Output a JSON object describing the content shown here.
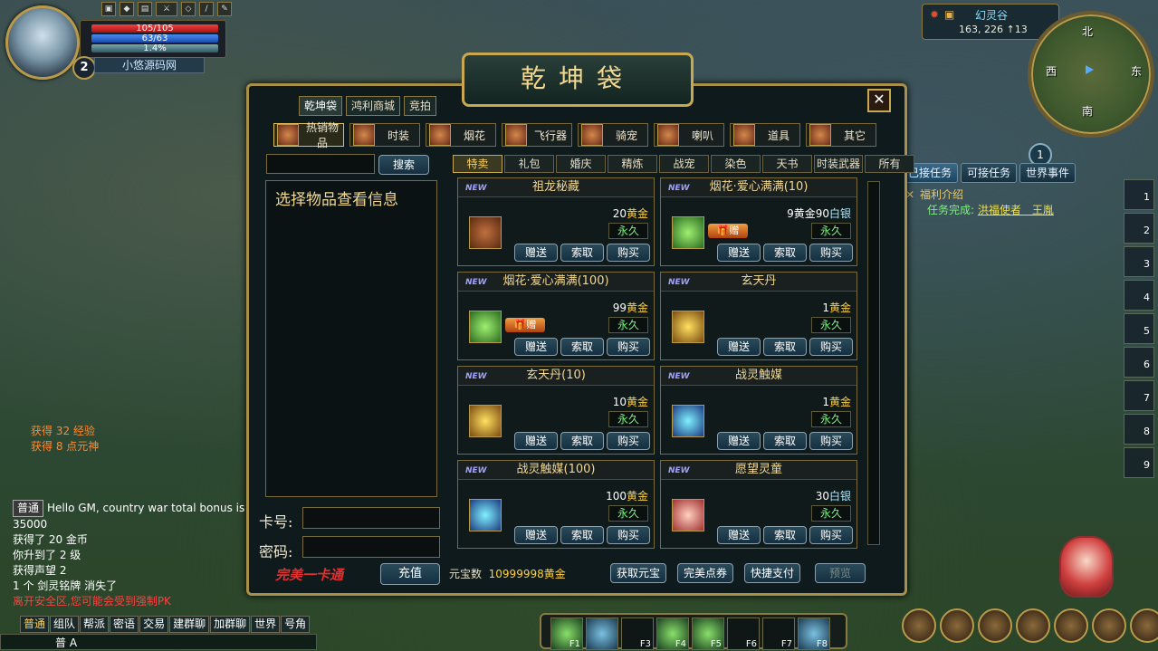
{
  "player": {
    "hp": "105/105",
    "mp": "63/63",
    "exp": "1.4%",
    "level": "2",
    "name": "小悠源码网"
  },
  "location": {
    "zone": "幻灵谷",
    "coords": "163, 226",
    "alt": "↑13"
  },
  "minimap": {
    "north": "北",
    "south": "南",
    "east": "东",
    "west": "西",
    "count": "1"
  },
  "quest_tabs": [
    "已接任务",
    "可接任务",
    "世界事件"
  ],
  "quest": {
    "title": "福利介绍",
    "status": "任务完成:",
    "target": "洪福使者　王胤"
  },
  "hotbar_right": [
    "1",
    "2",
    "3",
    "4",
    "5",
    "6",
    "7",
    "8",
    "9"
  ],
  "window": {
    "title": "乾坤袋",
    "top_tabs": [
      "乾坤袋",
      "鸿利商城",
      "竞拍"
    ],
    "categories": [
      "热销物品",
      "时装",
      "烟花",
      "飞行器",
      "骑宠",
      "喇叭",
      "道具",
      "其它"
    ],
    "search_label": "搜索",
    "info_text": "选择物品查看信息",
    "sub_tabs": [
      "特卖",
      "礼包",
      "婚庆",
      "精炼",
      "战宠",
      "染色",
      "天书",
      "时装武器",
      "所有"
    ],
    "card_label": "卡号:",
    "pwd_label": "密码:",
    "slogan": "完美一卡通",
    "charge_label": "充值",
    "balance_label": "元宝数",
    "balance_value": "10999998黄金",
    "bottom_buttons": [
      "获取元宝",
      "完美点券",
      "快捷支付",
      "预览"
    ],
    "new_tag": "NEW",
    "gift_tag": "赠",
    "button_gift": "赠送",
    "button_ask": "索取",
    "button_buy": "购买",
    "items": [
      {
        "name": "祖龙秘藏",
        "price": "20",
        "currency": "黄金",
        "duration": "永久",
        "gift": false,
        "icon": "book-icon"
      },
      {
        "name": "烟花·爱心满满(10)",
        "price": "9黄金90",
        "currency": "白银",
        "duration": "永久",
        "gift": true,
        "icon": "firework-icon"
      },
      {
        "name": "烟花·爱心满满(100)",
        "price": "99",
        "currency": "黄金",
        "duration": "永久",
        "gift": true,
        "icon": "firework-icon"
      },
      {
        "name": "玄天丹",
        "price": "1",
        "currency": "黄金",
        "duration": "永久",
        "gift": false,
        "icon": "pill-icon"
      },
      {
        "name": "玄天丹(10)",
        "price": "10",
        "currency": "黄金",
        "duration": "永久",
        "gift": false,
        "icon": "pill-icon"
      },
      {
        "name": "战灵触媒",
        "price": "1",
        "currency": "黄金",
        "duration": "永久",
        "gift": false,
        "icon": "orb-icon"
      },
      {
        "name": "战灵触媒(100)",
        "price": "100",
        "currency": "黄金",
        "duration": "永久",
        "gift": false,
        "icon": "orb-icon"
      },
      {
        "name": "愿望灵童",
        "price": "30",
        "currency": "白银",
        "duration": "永久",
        "gift": false,
        "icon": "doll-icon"
      }
    ]
  },
  "chat": {
    "sys": [
      "获得 32 经验",
      "获得 8 点元神"
    ],
    "channel_tag": "普通",
    "lines": [
      "Hello GM, country war total bonus is 35000",
      "获得了 20 金币",
      "你升到了 2 级",
      "获得声望 2",
      "1 个 剑灵铭牌 消失了"
    ],
    "warning": "离开安全区,您可能会受到强制PK",
    "tabs": [
      "普通",
      "组队",
      "帮派",
      "密语",
      "交易",
      "建群聊",
      "加群聊",
      "世界",
      "号角"
    ],
    "input_prefix": "普 A"
  },
  "skills": [
    "F1",
    "",
    "F3",
    "F4",
    "F5",
    "F6",
    "F7",
    "F8"
  ]
}
